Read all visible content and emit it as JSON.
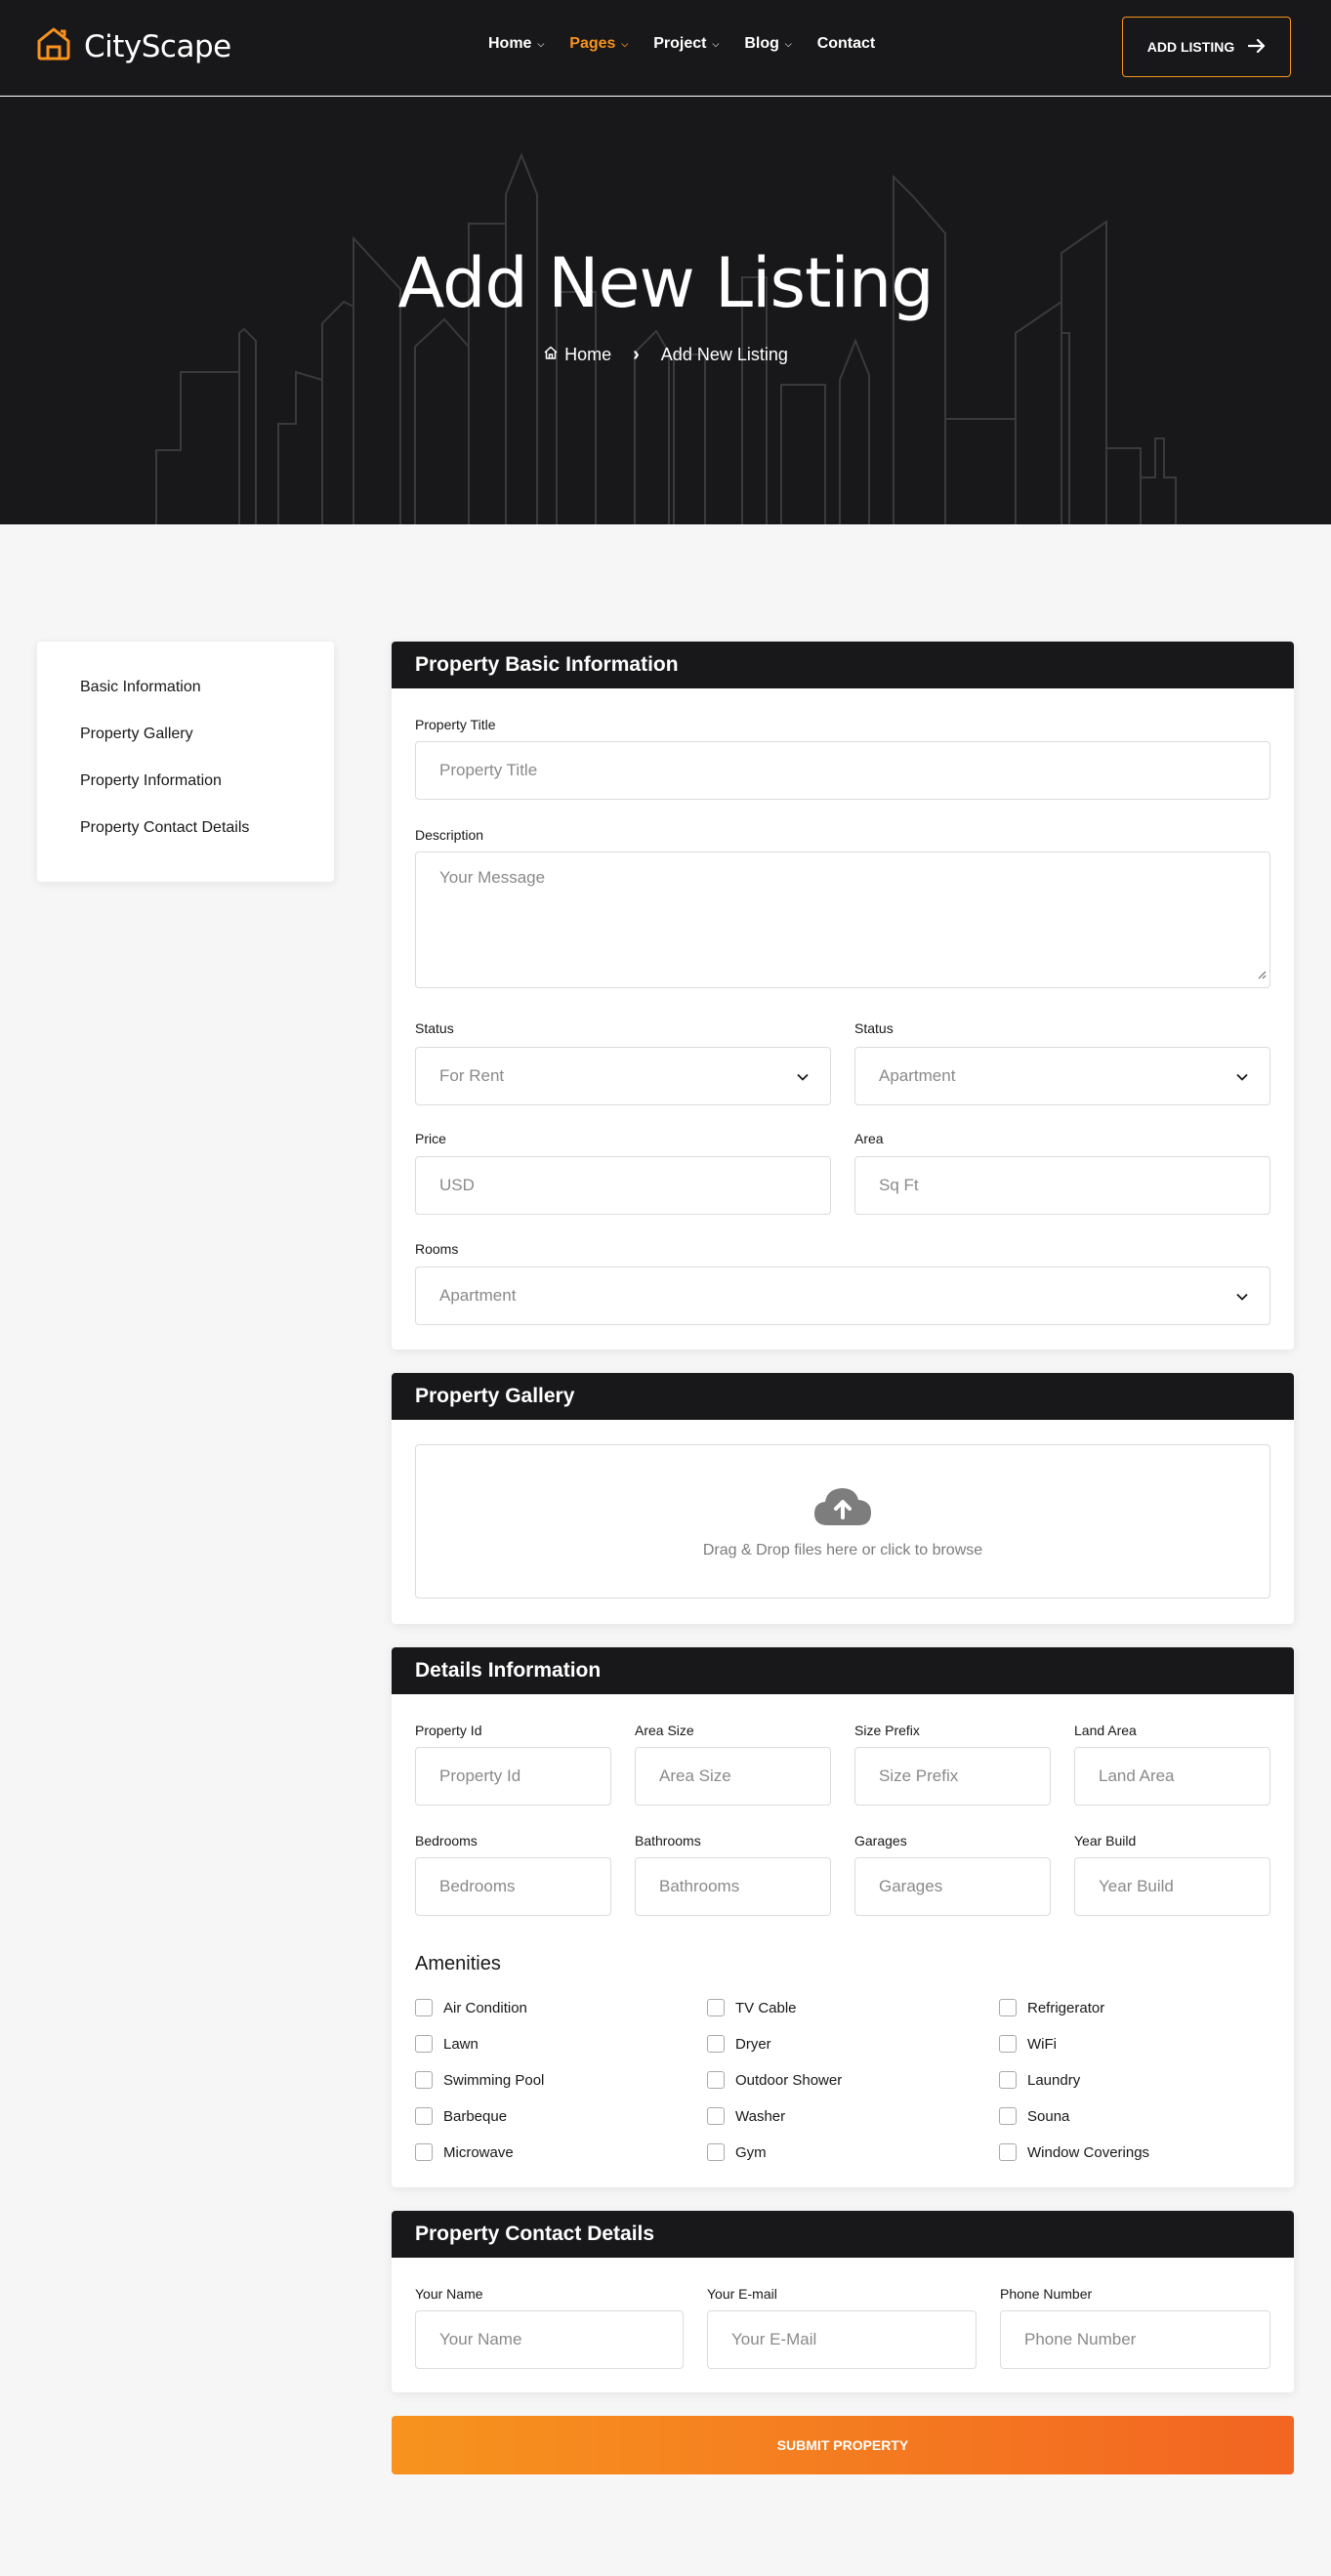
{
  "brand": {
    "name": "CityScape",
    "accent": "#f7931e",
    "dark": "#181719"
  },
  "nav": {
    "items": [
      {
        "label": "Home",
        "has_dropdown": true,
        "active": false
      },
      {
        "label": "Pages",
        "has_dropdown": true,
        "active": true
      },
      {
        "label": "Project",
        "has_dropdown": true,
        "active": false
      },
      {
        "label": "Blog",
        "has_dropdown": true,
        "active": false
      },
      {
        "label": "Contact",
        "has_dropdown": false,
        "active": false
      }
    ],
    "cta_label": "ADD LISTING"
  },
  "hero": {
    "title": "Add New Listing",
    "breadcrumb": {
      "home": "Home",
      "current": "Add New Listing"
    }
  },
  "sidebar": {
    "items": [
      {
        "label": "Basic Information"
      },
      {
        "label": "Property Gallery"
      },
      {
        "label": "Property Information"
      },
      {
        "label": "Property Contact Details"
      }
    ]
  },
  "basic_info": {
    "heading": "Property Basic Information",
    "title": {
      "label": "Property Title",
      "placeholder": "Property Title"
    },
    "description": {
      "label": "Description",
      "placeholder": "Your Message"
    },
    "status1": {
      "label": "Status",
      "value": "For Rent"
    },
    "status2": {
      "label": "Status",
      "value": "Apartment"
    },
    "price": {
      "label": "Price",
      "placeholder": "USD"
    },
    "area": {
      "label": "Area",
      "placeholder": "Sq Ft"
    },
    "rooms": {
      "label": "Rooms",
      "value": "Apartment"
    }
  },
  "gallery": {
    "heading": "Property Gallery",
    "dropzone_text": "Drag & Drop files here or click to browse",
    "icon": "cloud-upload-icon"
  },
  "details": {
    "heading": "Details Information",
    "fields": [
      {
        "label": "Property Id",
        "placeholder": "Property Id"
      },
      {
        "label": "Area Size",
        "placeholder": "Area Size"
      },
      {
        "label": "Size Prefix",
        "placeholder": "Size Prefix"
      },
      {
        "label": "Land Area",
        "placeholder": "Land Area"
      },
      {
        "label": "Bedrooms",
        "placeholder": "Bedrooms"
      },
      {
        "label": "Bathrooms",
        "placeholder": "Bathrooms"
      },
      {
        "label": "Garages",
        "placeholder": "Garages"
      },
      {
        "label": "Year Build",
        "placeholder": "Year Build"
      }
    ],
    "amenities_title": "Amenities",
    "amenities": [
      "Air Condition",
      "TV Cable",
      "Refrigerator",
      "Lawn",
      "Dryer",
      "WiFi",
      "Swimming Pool",
      "Outdoor Shower",
      "Laundry",
      "Barbeque",
      "Washer",
      "Souna",
      "Microwave",
      "Gym",
      "Window Coverings"
    ]
  },
  "contact": {
    "heading": "Property Contact Details",
    "name": {
      "label": "Your Name",
      "placeholder": "Your Name"
    },
    "email": {
      "label": "Your E-mail",
      "placeholder": "Your E-Mail"
    },
    "phone": {
      "label": "Phone Number",
      "placeholder": "Phone Number"
    }
  },
  "submit_label": "SUBMIT PROPERTY"
}
